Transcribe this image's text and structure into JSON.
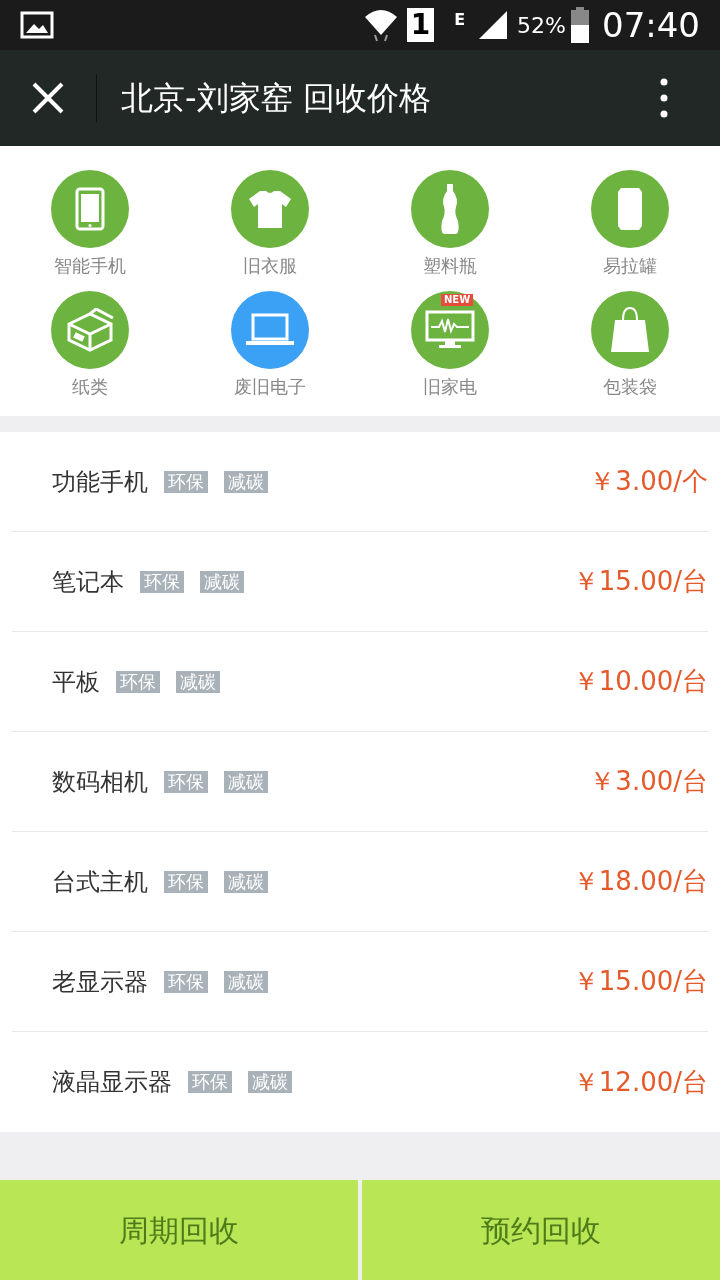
{
  "status_bar": {
    "sim_slot": "1",
    "network_type": "E",
    "battery": "52%",
    "time": "07:40"
  },
  "header": {
    "title": "北京-刘家窑 回收价格"
  },
  "categories": [
    {
      "label": "智能手机",
      "selected": false
    },
    {
      "label": "旧衣服",
      "selected": false
    },
    {
      "label": "塑料瓶",
      "selected": false
    },
    {
      "label": "易拉罐",
      "selected": false
    },
    {
      "label": "纸类",
      "selected": false
    },
    {
      "label": "废旧电子",
      "selected": true
    },
    {
      "label": "旧家电",
      "selected": false,
      "badge": "NEW"
    },
    {
      "label": "包装袋",
      "selected": false
    }
  ],
  "items": [
    {
      "name": "功能手机",
      "tags": [
        "环保",
        "减碳"
      ],
      "price": "￥3.00/个"
    },
    {
      "name": "笔记本",
      "tags": [
        "环保",
        "减碳"
      ],
      "price": "￥15.00/台"
    },
    {
      "name": "平板",
      "tags": [
        "环保",
        "减碳"
      ],
      "price": "￥10.00/台"
    },
    {
      "name": "数码相机",
      "tags": [
        "环保",
        "减碳"
      ],
      "price": "￥3.00/台"
    },
    {
      "name": "台式主机",
      "tags": [
        "环保",
        "减碳"
      ],
      "price": "￥18.00/台"
    },
    {
      "name": "老显示器",
      "tags": [
        "环保",
        "减碳"
      ],
      "price": "￥15.00/台"
    },
    {
      "name": "液晶显示器",
      "tags": [
        "环保",
        "减碳"
      ],
      "price": "￥12.00/台"
    }
  ],
  "buttons": [
    "周期回收",
    "预约回收"
  ]
}
